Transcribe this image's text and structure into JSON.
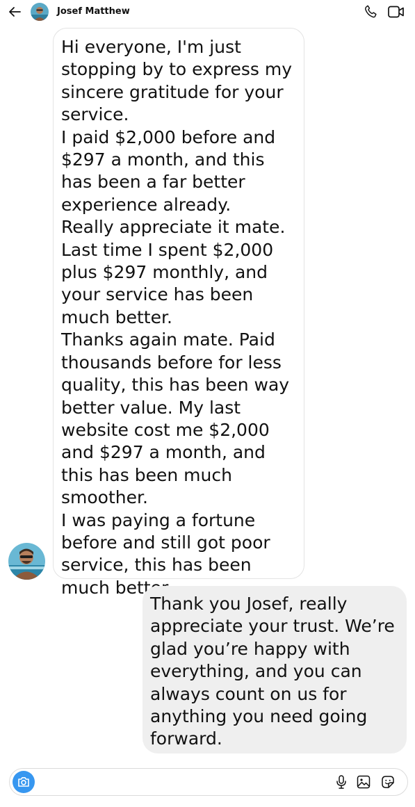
{
  "header": {
    "contact_name": "Josef Matthew",
    "icons": [
      "back-arrow-icon",
      "avatar",
      "phone-icon",
      "video-camera-icon"
    ]
  },
  "incoming_message": {
    "paragraphs": [
      "Hi everyone, I'm just stopping by to express my sincere gratitude for your service.",
      "I paid $2,000 before and $297 a month, and this has been a far better experience already.",
      "Really appreciate it mate. Last time I spent $2,000 plus $297 monthly, and your service has been much better.",
      "Thanks again mate. Paid thousands before for less quality, this has been way better value. My last website cost me $2,000 and $297 a month, and this has been much smoother.",
      "I was paying a fortune before and still got poor service, this has been much better."
    ]
  },
  "outgoing_message": {
    "text": "Thank you Josef, really appreciate your trust. We’re glad you’re happy with everything, and you can always count on us for anything you need going forward."
  },
  "composer": {
    "icons": [
      "camera-icon",
      "microphone-icon",
      "gallery-icon",
      "sticker-icon"
    ]
  },
  "colors": {
    "accent": "#3797f0",
    "outgoing_bubble": "#efefef",
    "incoming_border": "#e3e3e3"
  }
}
